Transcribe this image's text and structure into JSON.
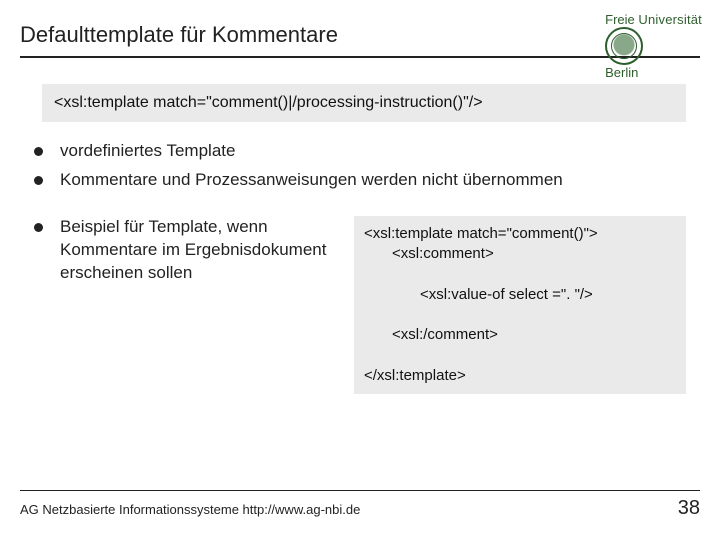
{
  "header": {
    "title": "Defaulttemplate für Kommentare",
    "logo_text1": "Freie",
    "logo_text2": "Universität",
    "logo_text3": "Berlin"
  },
  "code_top": "<xsl:template match=\"comment()|/processing-instruction()\"/>",
  "bullets_top": [
    "vordefiniertes Template",
    "Kommentare und Prozessanweisungen werden nicht übernommen"
  ],
  "bullet_left": "Beispiel für Template, wenn Kommentare im Ergebnisdokument erscheinen sollen",
  "code_example": {
    "l1": "<xsl:template match=\"comment()\">",
    "l2": "<xsl:comment>",
    "l3": "<xsl:value-of select =\". \"/>",
    "l4": "<xsl:/comment>",
    "l5": "</xsl:template>"
  },
  "footer": {
    "org": "AG Netzbasierte Informationssysteme http://www.ag-nbi.de",
    "page": "38"
  }
}
